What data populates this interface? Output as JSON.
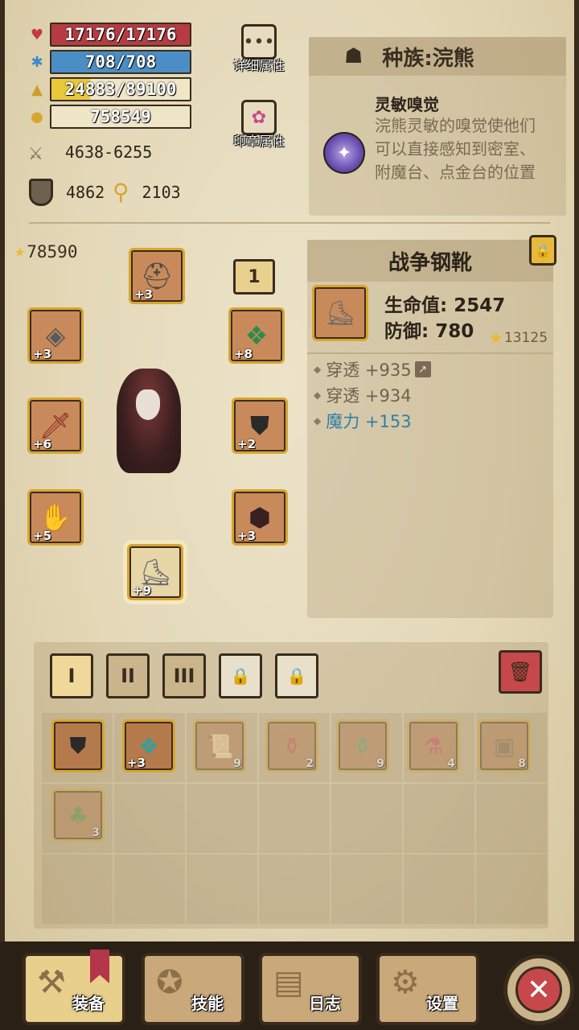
{
  "stats": {
    "hp": "17176/17176",
    "mp": "708/708",
    "xp": "24883/89100",
    "gold": "758549",
    "attack": "4638-6255",
    "defense": "4862",
    "magic": "2103"
  },
  "side_buttons": {
    "detail_label": "详细属性",
    "seal_label": "印章属性"
  },
  "race": {
    "title": "种族:浣熊",
    "skill_name": "灵敏嗅觉",
    "skill_desc": "浣熊灵敏的嗅觉使他们可以直接感知到密室、附魔台、点金台的位置"
  },
  "equipment": {
    "power": "78590",
    "slot_number": "1",
    "slots": [
      {
        "name": "helmet",
        "icon": "helmet-icon",
        "level": "+3"
      },
      {
        "name": "amulet",
        "icon": "amulet-icon",
        "level": "+8"
      },
      {
        "name": "ring",
        "icon": "ring-icon",
        "level": "+3"
      },
      {
        "name": "weapon",
        "icon": "sword-icon",
        "level": "+6"
      },
      {
        "name": "armor",
        "icon": "armor-icon",
        "level": "+2"
      },
      {
        "name": "gloves",
        "icon": "gauntlet-icon",
        "level": "+5"
      },
      {
        "name": "shield",
        "icon": "shield-icon",
        "level": "+3"
      },
      {
        "name": "boots",
        "icon": "boots-icon",
        "level": "+9"
      }
    ]
  },
  "item": {
    "name": "战争钢靴",
    "hp": "生命值: 2547",
    "defense": "防御: 780",
    "score": "13125",
    "affixes": [
      {
        "text": "穿透 +935",
        "color": "#6e6150"
      },
      {
        "text": "穿透 +934",
        "color": "#6e6150"
      },
      {
        "text": "魔力 +153",
        "color": "#2f7fa6"
      }
    ]
  },
  "inventory": {
    "tabs": [
      "I",
      "II",
      "III"
    ],
    "items": [
      {
        "icon": "armor-icon",
        "level": "",
        "count": "",
        "faded": false
      },
      {
        "icon": "amulet-icon",
        "level": "+3",
        "count": "",
        "faded": false
      },
      {
        "icon": "scroll-icon",
        "level": "",
        "count": "9",
        "faded": true
      },
      {
        "icon": "red-potion-icon",
        "level": "",
        "count": "2",
        "faded": true
      },
      {
        "icon": "green-potion-icon",
        "level": "",
        "count": "9",
        "faded": true
      },
      {
        "icon": "red-flask-icon",
        "level": "",
        "count": "4",
        "faded": true
      },
      {
        "icon": "chest-icon",
        "level": "",
        "count": "8",
        "faded": true
      },
      {
        "icon": "tree-icon",
        "level": "",
        "count": "3",
        "faded": true
      }
    ]
  },
  "nav": {
    "equip": "装备",
    "skill": "技能",
    "log": "日志",
    "settings": "设置"
  },
  "colors": {
    "hp_bar": "#b53d42",
    "mp_bar": "#4b8ec5",
    "xp_bar": "#e9c93c",
    "affix_blue": "#2f7fa6",
    "gold_border": "#d9a530"
  }
}
